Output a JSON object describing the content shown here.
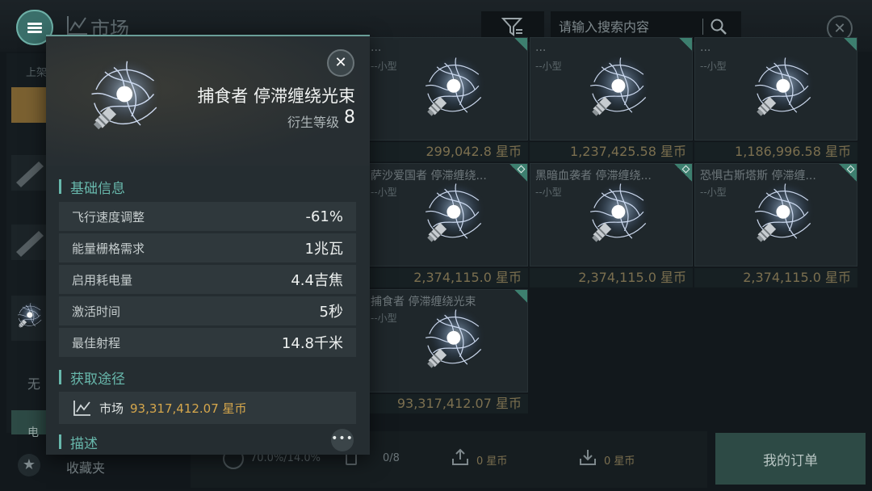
{
  "header": {
    "title": "市场",
    "search_placeholder": "请输入搜索内容"
  },
  "left_column": {
    "label_top": "上架",
    "label_bottom": "无",
    "accent_label": "电"
  },
  "grid": {
    "cards": [
      {
        "name": "...",
        "size": "--小型",
        "price": "299,042.8 星币",
        "diamond": false
      },
      {
        "name": "...",
        "size": "--小型",
        "price": "1,237,425.58 星币",
        "diamond": false
      },
      {
        "name": "...",
        "size": "--小型",
        "price": "1,186,996.58 星币",
        "diamond": false
      },
      {
        "name": "萨沙爱国者 停滞缠绕...",
        "size": "--小型",
        "price": "2,374,115.0 星币",
        "diamond": true
      },
      {
        "name": "黑暗血袭者 停滞缠绕...",
        "size": "--小型",
        "price": "2,374,115.0 星币",
        "diamond": true
      },
      {
        "name": "恐惧古斯塔斯 停滞缠...",
        "size": "--小型",
        "price": "2,374,115.0 星币",
        "diamond": true
      },
      {
        "name": "捕食者 停滞缠绕光束",
        "size": "--小型",
        "price": "93,317,412.07 星币",
        "diamond": false
      }
    ]
  },
  "bottom_bar": {
    "favorites_label": "收藏夹",
    "percent_text": "70.0%/14.0%",
    "count_text": "0/8",
    "upload_value": "0 星币",
    "download_value": "0 星币",
    "orders_label": "我的订单"
  },
  "popup": {
    "item_name": "捕食者 停滞缠绕光束",
    "level_label": "衍生等级",
    "level_value": "8",
    "section_basic": "基础信息",
    "stats": [
      {
        "label": "飞行速度调整",
        "value": "-61%"
      },
      {
        "label": "能量栅格需求",
        "value": "1兆瓦"
      },
      {
        "label": "启用耗电量",
        "value": "4.4吉焦"
      },
      {
        "label": "激活时间",
        "value": "5秒"
      },
      {
        "label": "最佳射程",
        "value": "14.8千米"
      }
    ],
    "section_source": "获取途径",
    "source_label": "市场",
    "source_price": "93,317,412.07 星币",
    "section_desc": "描述",
    "more_label": "..."
  },
  "colors": {
    "accent": "#68b8ac",
    "price_gold": "#d6a74c",
    "orders_bg": "#2d4a45"
  },
  "icons": {
    "menu": "menu-icon",
    "market": "market-chart-icon",
    "filter": "filter-icon",
    "search": "search-icon",
    "close": "close-icon",
    "star": "star-icon",
    "more": "more-icon"
  }
}
